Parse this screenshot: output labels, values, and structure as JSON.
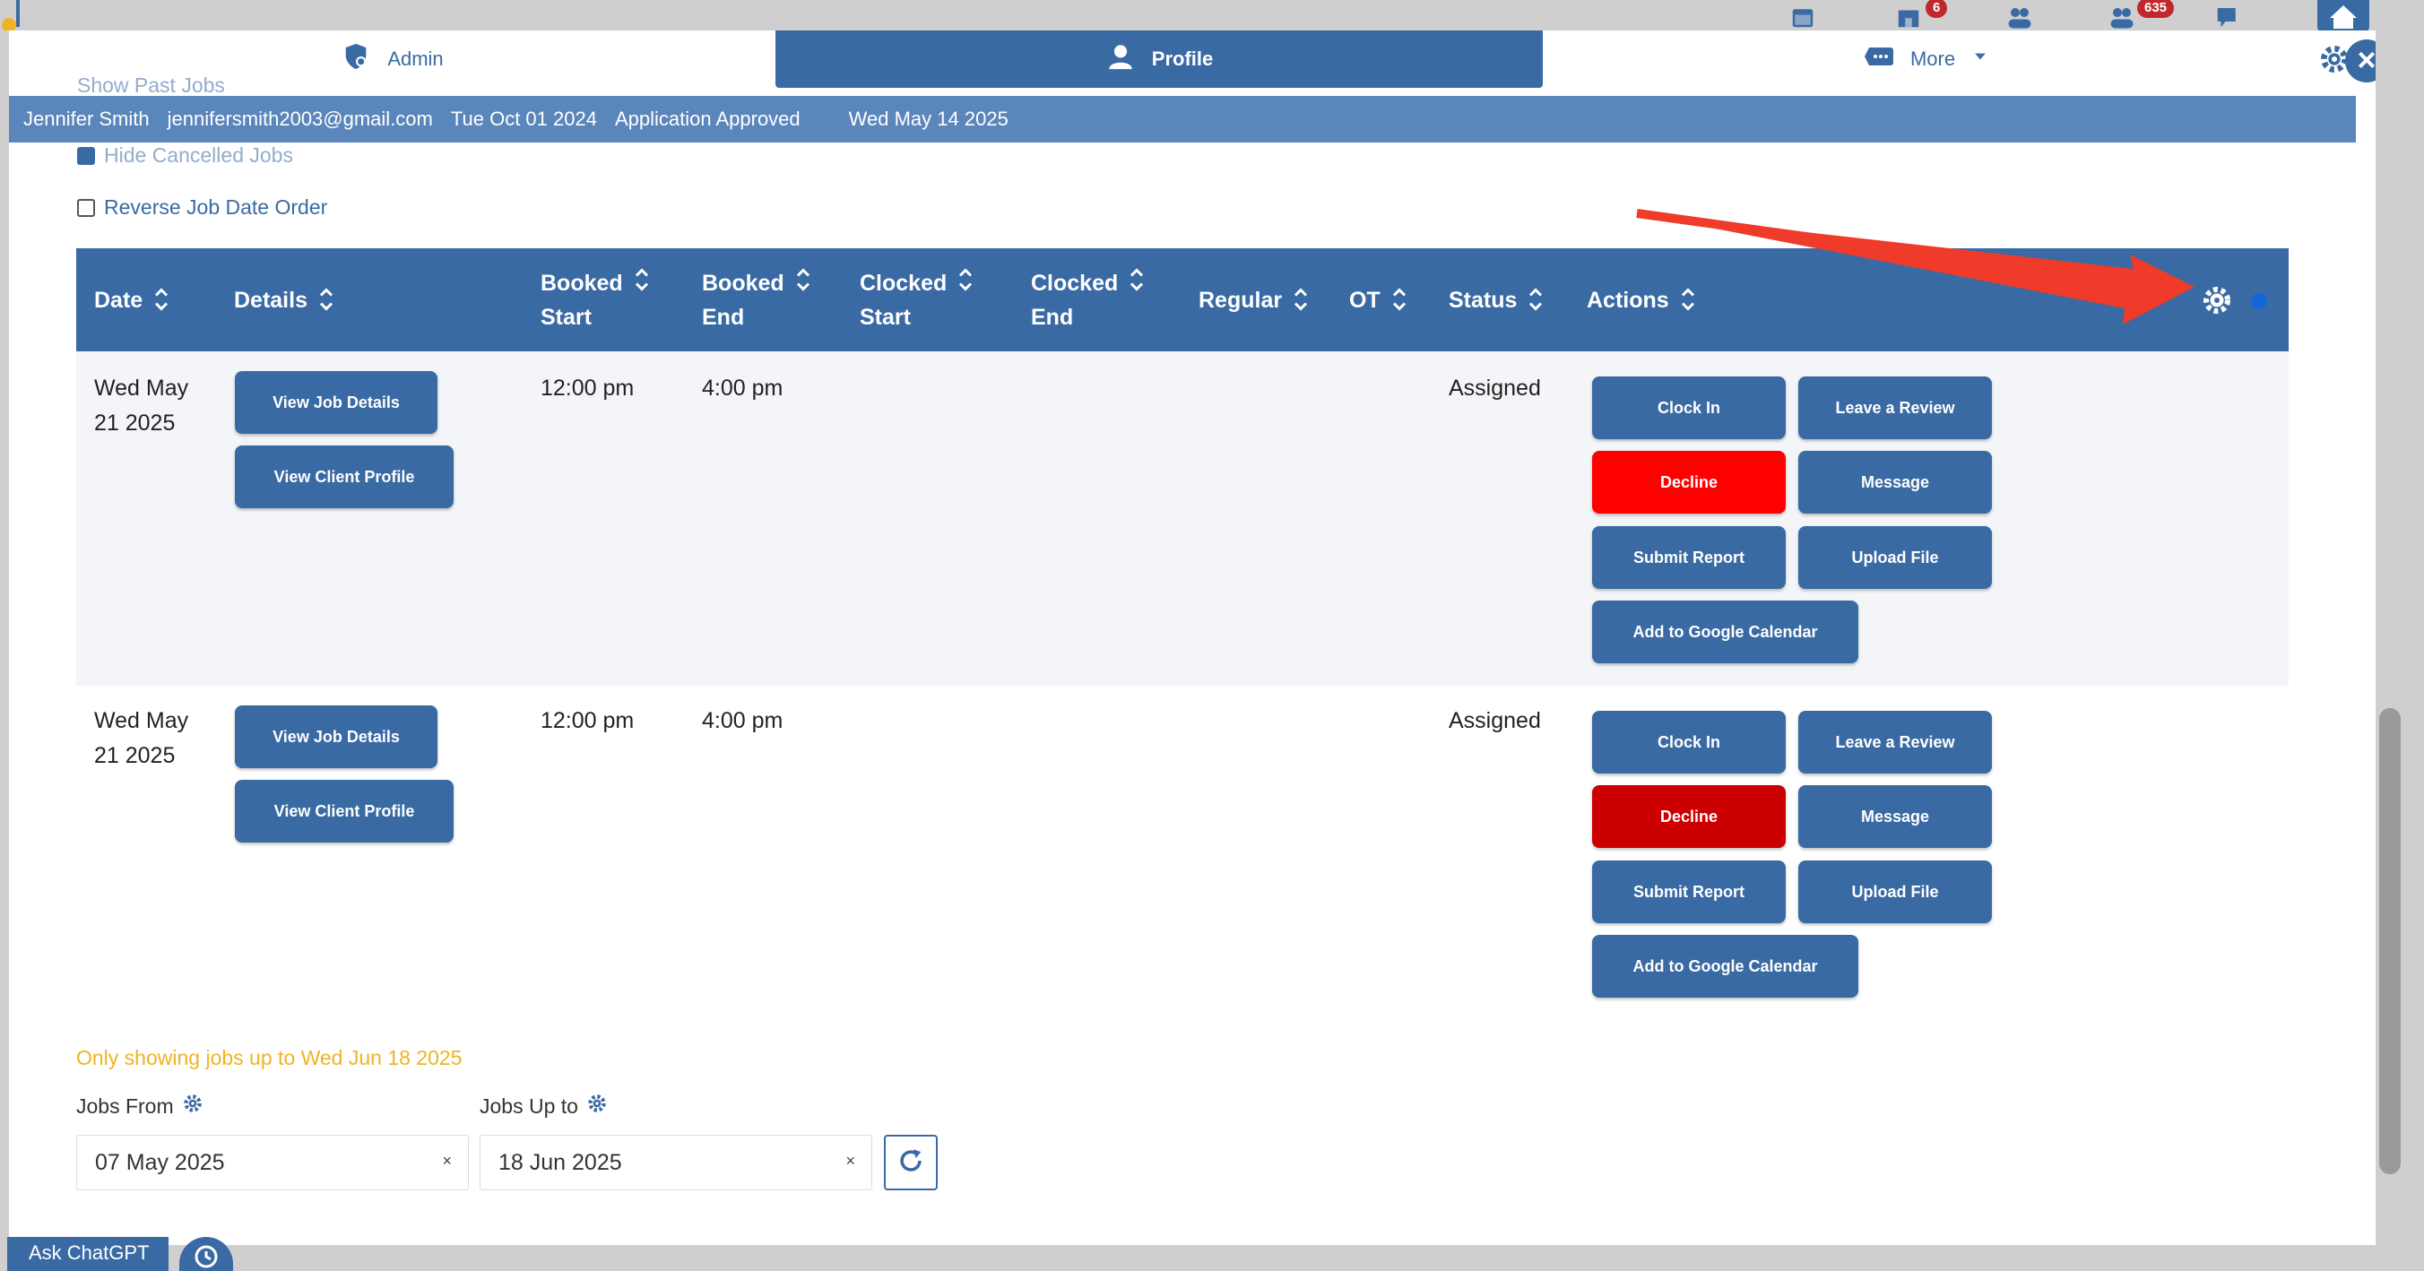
{
  "top_bar": {
    "badges": [
      "6",
      "635"
    ],
    "icons": [
      "calendar-icon",
      "store-icon",
      "users-icon",
      "team-icon",
      "chat-icon",
      "home-icon"
    ]
  },
  "tabs": [
    {
      "label": "Admin",
      "icon": "shield-user-icon"
    },
    {
      "label": "Profile",
      "icon": "person-icon"
    },
    {
      "label": "More",
      "icon": "ellipsis-tag-icon"
    }
  ],
  "info_bar": {
    "name": "Jennifer Smith",
    "email": "jennifersmith2003@gmail.com",
    "date": "Tue Oct 01 2024",
    "status": "Application Approved",
    "date2": "Wed May 14 2025"
  },
  "options": {
    "show_past_label": "Show Past Jobs",
    "hide_cancelled_label": "Hide Cancelled Jobs",
    "reverse_order_label": "Reverse Job Date Order"
  },
  "table": {
    "headers": {
      "date": "Date",
      "details": "Details",
      "booked_start_1": "Booked",
      "booked_start_2": "Start",
      "booked_end_1": "Booked",
      "booked_end_2": "End",
      "clocked_start_1": "Clocked",
      "clocked_start_2": "Start",
      "clocked_end_1": "Clocked",
      "clocked_end_2": "End",
      "regular": "Regular",
      "ot": "OT",
      "status": "Status",
      "actions": "Actions"
    },
    "rows": [
      {
        "date_1": "Wed May",
        "date_2": "21 2025",
        "booked_start": "12:00 pm",
        "booked_end": "4:00 pm",
        "status": "Assigned",
        "btn_job_details": "View Job Details",
        "btn_client_profile": "View Client Profile",
        "btn_clock_in": "Clock In",
        "btn_leave_review": "Leave a Review",
        "btn_decline": "Decline",
        "btn_message": "Message",
        "btn_submit_report": "Submit Report",
        "btn_upload_file": "Upload File",
        "btn_google_calendar": "Add to Google Calendar"
      },
      {
        "date_1": "Wed May",
        "date_2": "21 2025",
        "booked_start": "12:00 pm",
        "booked_end": "4:00 pm",
        "status": "Assigned",
        "btn_job_details": "View Job Details",
        "btn_client_profile": "View Client Profile",
        "btn_clock_in": "Clock In",
        "btn_leave_review": "Leave a Review",
        "btn_decline": "Decline",
        "btn_message": "Message",
        "btn_submit_report": "Submit Report",
        "btn_upload_file": "Upload File",
        "btn_google_calendar": "Add to Google Calendar"
      }
    ]
  },
  "filters": {
    "note": "Only showing jobs up to Wed Jun 18 2025",
    "from_label": "Jobs From",
    "to_label": "Jobs Up to",
    "from_value": "07 May 2025",
    "to_value": "18 Jun 2025",
    "clear_symbol": "×"
  },
  "bottom": {
    "ask_chatgpt": "Ask ChatGPT"
  },
  "colors": {
    "primary": "#3a6aa3",
    "info_bar": "#5a86bb",
    "decline_red": "#ff0000",
    "decline_dark_red": "#cc0000",
    "note_yellow": "#f0b323",
    "annotation_arrow": "#f03a2a"
  }
}
